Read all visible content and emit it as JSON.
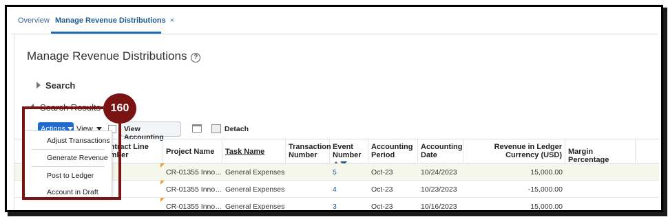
{
  "tabs": {
    "overview": "Overview",
    "active": "Manage Revenue Distributions",
    "close": "×"
  },
  "page": {
    "title": "Manage Revenue Distributions",
    "help": "?"
  },
  "search": {
    "label": "Search"
  },
  "results": {
    "label": "Search Results",
    "help": "?"
  },
  "toolbar": {
    "actions": "Actions",
    "view": "View",
    "view_accounting": "View Accounting",
    "detach": "Detach"
  },
  "columns": {
    "contract_line": "Contract Line Number",
    "project_name": "Project Name",
    "task_name": "Task Name",
    "transaction_number": "Transaction Number",
    "event_number": "Event Number",
    "accounting_period": "Accounting Period",
    "accounting_date": "Accounting Date",
    "revenue_ledger": "Revenue in Ledger Currency (USD)",
    "margin_percentage": "Margin Percentage"
  },
  "rows": [
    {
      "project": "CR-01355 Inno…",
      "task": "General Expenses",
      "event": "5",
      "period": "Oct-23",
      "date": "10/24/2023",
      "revenue": "15,000.00"
    },
    {
      "project": "CR-01355 Inno…",
      "task": "General Expenses",
      "event": "4",
      "period": "Oct-23",
      "date": "10/23/2023",
      "revenue": "-15,000.00"
    },
    {
      "project": "CR-01355 Inno…",
      "task": "General Expenses",
      "event": "3",
      "period": "Oct-23",
      "date": "10/16/2023",
      "revenue": "15,000.00"
    }
  ],
  "actions_menu": {
    "items": [
      "Adjust Transactions",
      "Generate Revenue",
      "Post to Ledger",
      "Account in Draft"
    ]
  },
  "annotation": {
    "badge": "160",
    "color": "#7a1414"
  },
  "colors": {
    "accent": "#1f6bd1",
    "link": "#1f5b8f",
    "selected_row": "#f4f7e9"
  }
}
